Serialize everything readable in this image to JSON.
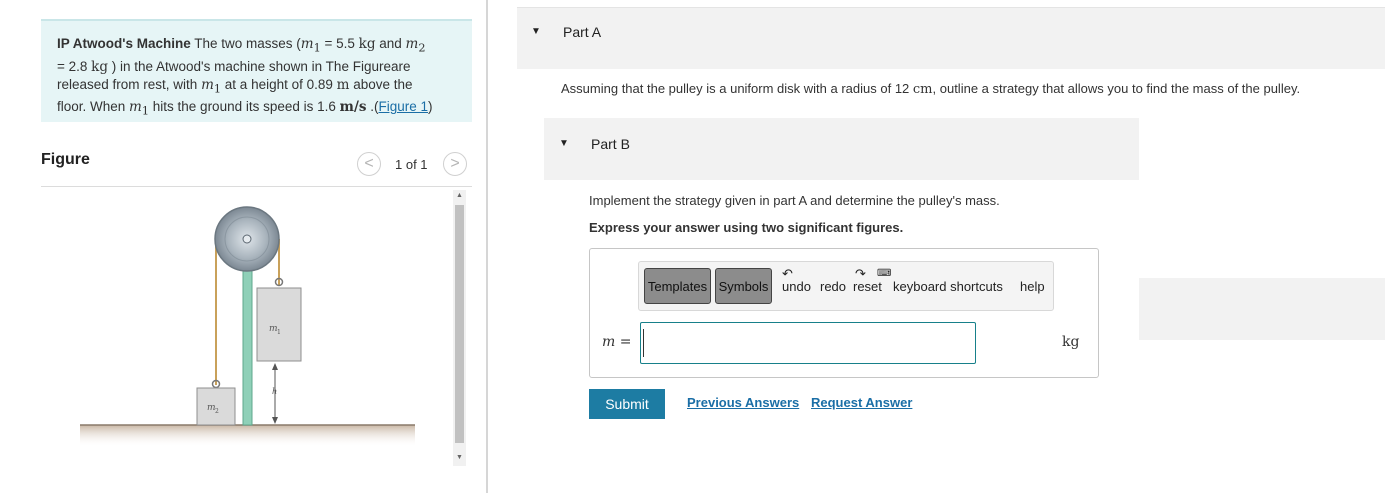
{
  "problem": {
    "title": "IP Atwood's Machine",
    "line1_a": "The two masses (",
    "m1_sym": "m",
    "m1_sub": "1",
    "m1_val": " = 5.5 ",
    "unit_kg": "kg",
    "and": " and ",
    "m2_sym": "m",
    "m2_sub": "2",
    "line2_a": "= 2.8 ",
    "line2_b": " ) in the Atwood's machine shown in The Figureare",
    "line3_a": "released from rest, with ",
    "line3_b": " at a height of 0.89 ",
    "unit_m": "m",
    "line3_c": " above the",
    "line4_a": "floor. When ",
    "line4_b": " hits the ground its speed is 1.6 ",
    "unit_ms": "m/s",
    "line4_c": " .(",
    "figure_link": "Figure 1",
    "line4_d": ")"
  },
  "figure": {
    "label": "Figure",
    "counter": "1 of 1",
    "prev": "<",
    "next": ">",
    "m1_label": "m",
    "m1_sub": "1",
    "m2_label": "m",
    "m2_sub": "2",
    "h_label": "h"
  },
  "partA": {
    "title": "Part A",
    "text_a": "Assuming that the pulley is a uniform disk with a radius of 12 ",
    "unit": "cm",
    "text_b": ", outline a strategy that allows you to find the mass of the pulley."
  },
  "partB": {
    "title": "Part B",
    "text": "Implement the strategy given in part A and determine the pulley's mass.",
    "instruction": "Express your answer using two significant figures.",
    "toolbar": {
      "templates": "Templates",
      "symbols": "Symbols",
      "undo": "undo",
      "redo": "redo",
      "reset": "reset",
      "keyboard": "keyboard shortcuts",
      "help": "help"
    },
    "var_label": "m =",
    "answer_value": "",
    "unit": "kg",
    "submit": "Submit",
    "previous_answers": "Previous Answers",
    "request_answer": "Request Answer"
  },
  "colors": {
    "accent": "#1d7ca3",
    "link": "#1a6ea6",
    "problem_bg": "#e6f5f6",
    "input_border": "#17808a"
  }
}
